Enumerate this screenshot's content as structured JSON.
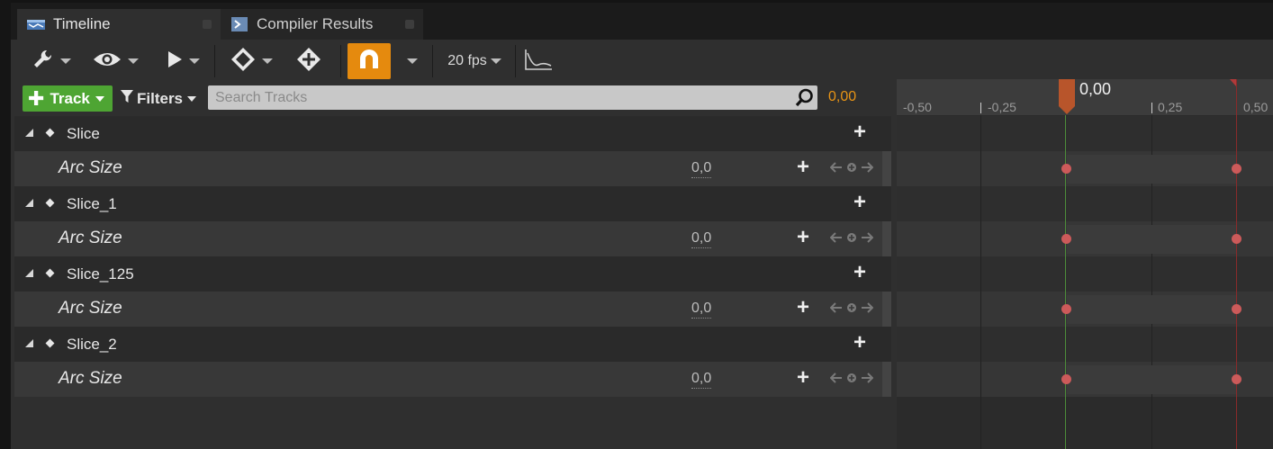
{
  "tabs": [
    {
      "label": "Timeline",
      "active": true
    },
    {
      "label": "Compiler Results",
      "active": false
    }
  ],
  "toolbar": {
    "icons": [
      "wrench-icon",
      "eye-icon",
      "play-icon",
      "key-diamond-icon",
      "add-key-icon",
      "snap-magnet-icon",
      "curve-icon"
    ],
    "fps_label": "20 fps"
  },
  "track_bar": {
    "add_track_label": "Track",
    "filters_label": "Filters",
    "search_placeholder": "Search Tracks",
    "current_time": "0,00"
  },
  "tracks": [
    {
      "name": "Slice",
      "property": "Arc Size",
      "value": "0,0"
    },
    {
      "name": "Slice_1",
      "property": "Arc Size",
      "value": "0,0"
    },
    {
      "name": "Slice_125",
      "property": "Arc Size",
      "value": "0,0"
    },
    {
      "name": "Slice_2",
      "property": "Arc Size",
      "value": "0,0"
    }
  ],
  "ruler": {
    "ticks": [
      "-0,50",
      "-0,25",
      "0,25",
      "0,50"
    ],
    "playhead_time": "0,00"
  },
  "colors": {
    "accent_orange": "#e58a0e",
    "add_green": "#4ea533",
    "key_red": "#cc5a5a",
    "playhead_green": "#4d8d3a",
    "time_text": "#e89416"
  }
}
